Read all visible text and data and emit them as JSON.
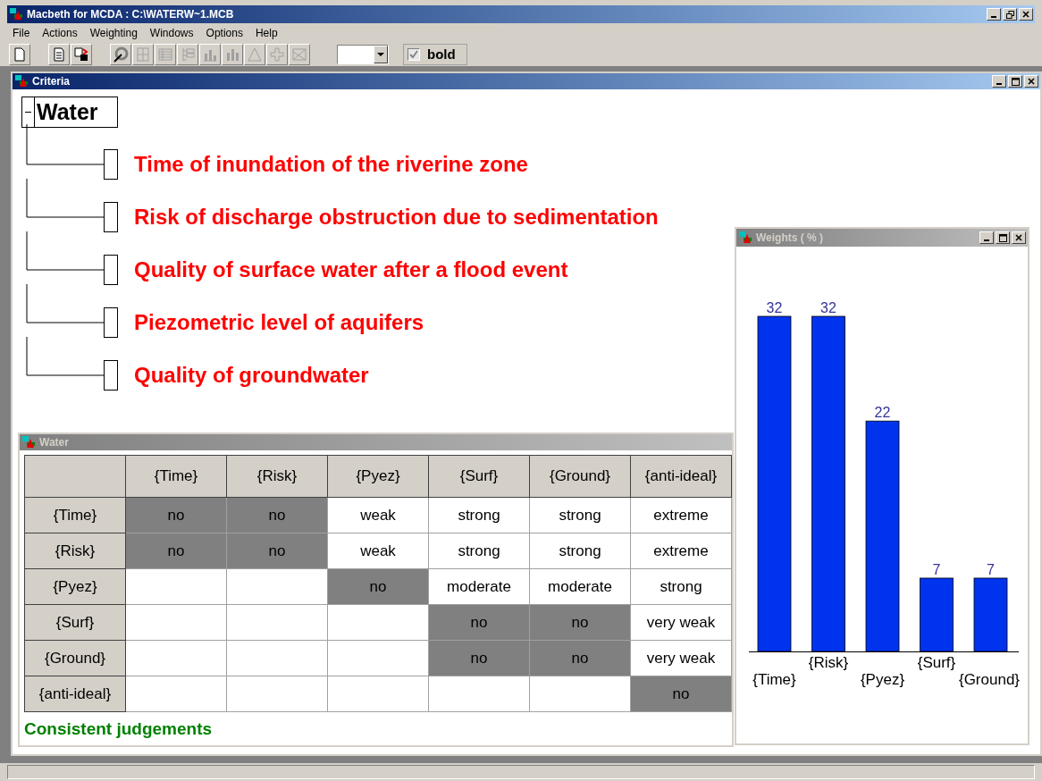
{
  "window": {
    "title": "Macbeth for MCDA : C:\\WATERW~1.MCB"
  },
  "menu": [
    "File",
    "Actions",
    "Weighting",
    "Windows",
    "Options",
    "Help"
  ],
  "toolbar": {
    "bold_checkbox": {
      "label": "bold",
      "checked": true
    }
  },
  "criteria_window": {
    "title": "Criteria",
    "tree": {
      "label": "Water",
      "expanded": true,
      "children": [
        {
          "label": "Time of inundation of the riverine zone"
        },
        {
          "label": "Risk of discharge obstruction due to sedimentation"
        },
        {
          "label": "Quality of surface water after a flood event"
        },
        {
          "label": "Piezometric level of aquifers"
        },
        {
          "label": "Quality of groundwater"
        }
      ]
    }
  },
  "matrix_window": {
    "title": "Water",
    "columns": [
      "{Time}",
      "{Risk}",
      "{Pyez}",
      "{Surf}",
      "{Ground}",
      "{anti-ideal}"
    ],
    "rows": [
      {
        "header": "{Time}",
        "cells": [
          {
            "text": "no",
            "shaded": true
          },
          {
            "text": "no",
            "shaded": true
          },
          {
            "text": "weak",
            "shaded": false
          },
          {
            "text": "strong",
            "shaded": false
          },
          {
            "text": "strong",
            "shaded": false
          },
          {
            "text": "extreme",
            "shaded": false
          }
        ]
      },
      {
        "header": "{Risk}",
        "cells": [
          {
            "text": "no",
            "shaded": true
          },
          {
            "text": "no",
            "shaded": true
          },
          {
            "text": "weak",
            "shaded": false
          },
          {
            "text": "strong",
            "shaded": false
          },
          {
            "text": "strong",
            "shaded": false
          },
          {
            "text": "extreme",
            "shaded": false
          }
        ]
      },
      {
        "header": "{Pyez}",
        "cells": [
          {
            "shaded": false
          },
          {
            "shaded": false
          },
          {
            "text": "no",
            "shaded": true
          },
          {
            "text": "moderate",
            "shaded": false
          },
          {
            "text": "moderate",
            "shaded": false
          },
          {
            "text": "strong",
            "shaded": false
          }
        ]
      },
      {
        "header": "{Surf}",
        "cells": [
          {
            "shaded": false
          },
          {
            "shaded": false
          },
          {
            "shaded": false
          },
          {
            "text": "no",
            "shaded": true
          },
          {
            "text": "no",
            "shaded": true
          },
          {
            "text": "very weak",
            "shaded": false
          }
        ]
      },
      {
        "header": "{Ground}",
        "cells": [
          {
            "shaded": false
          },
          {
            "shaded": false
          },
          {
            "shaded": false
          },
          {
            "text": "no",
            "shaded": true
          },
          {
            "text": "no",
            "shaded": true
          },
          {
            "text": "very weak",
            "shaded": false
          }
        ]
      },
      {
        "header": "{anti-ideal}",
        "cells": [
          {
            "shaded": false
          },
          {
            "shaded": false
          },
          {
            "shaded": false
          },
          {
            "shaded": false
          },
          {
            "shaded": false
          },
          {
            "text": "no",
            "shaded": true
          }
        ]
      }
    ],
    "status": "Consistent judgements"
  },
  "weights_window": {
    "title": "Weights ( % )",
    "chart_data": {
      "type": "bar",
      "categories": [
        "{Time}",
        "{Risk}",
        "{Pyez}",
        "{Surf}",
        "{Ground}"
      ],
      "values": [
        32,
        32,
        22,
        7,
        7
      ],
      "data_labels": true
    }
  }
}
